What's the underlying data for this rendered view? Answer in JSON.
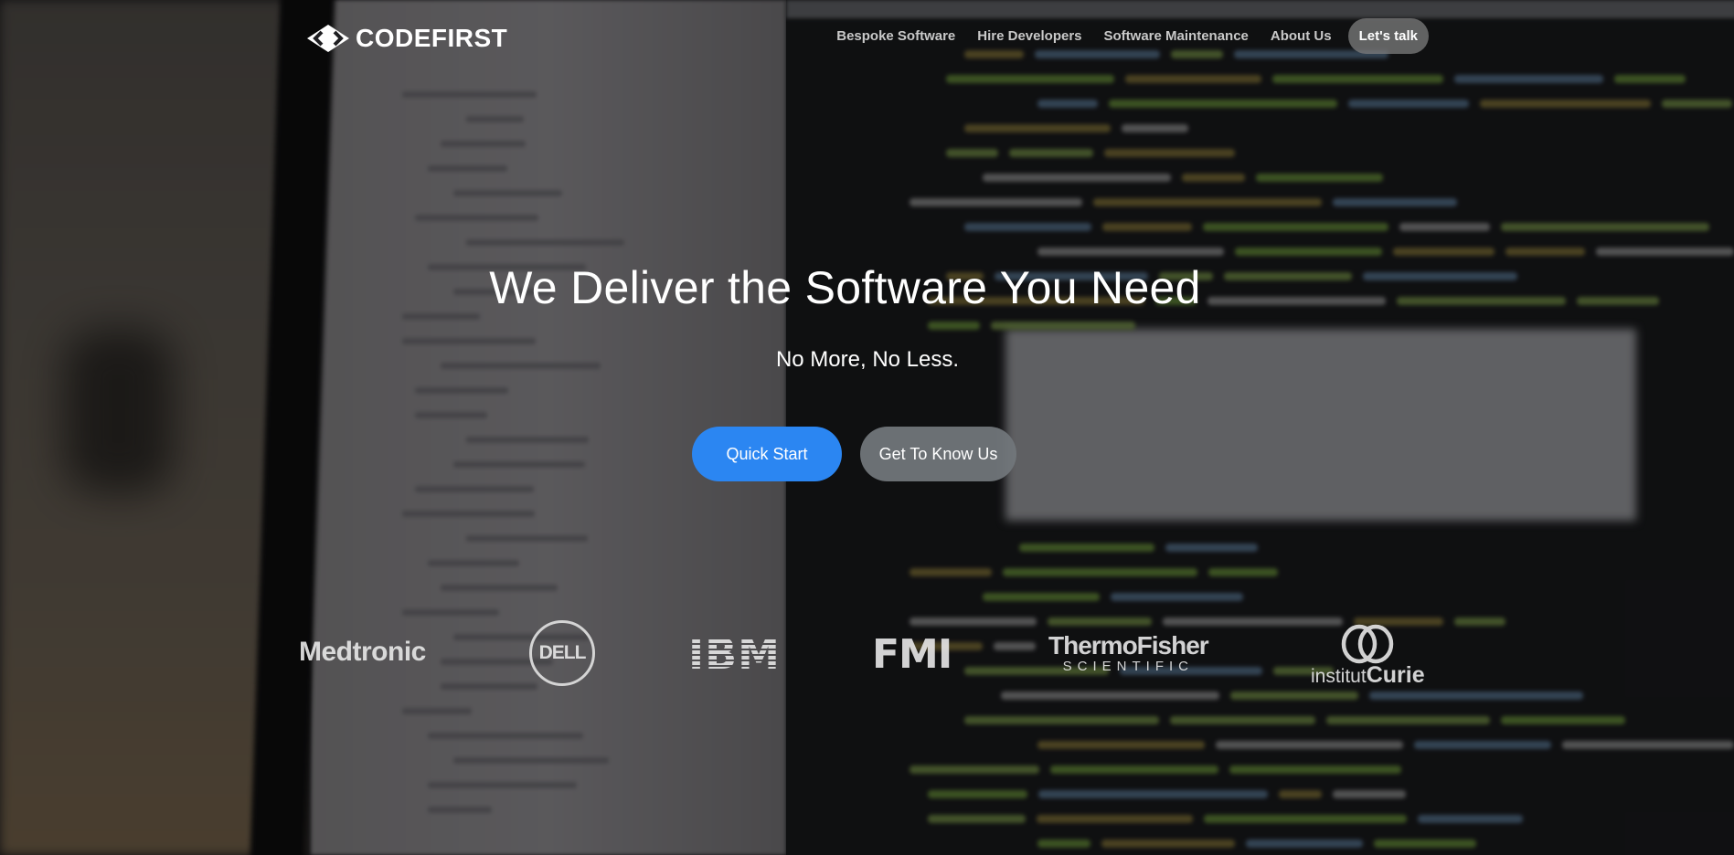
{
  "brand": {
    "logo_text": "CODEFIRST",
    "logo_icon": "diamond-chevrons-icon"
  },
  "nav": {
    "links": [
      "Bespoke Software",
      "Hire Developers",
      "Software Maintenance",
      "About Us"
    ],
    "cta": "Let's talk"
  },
  "hero": {
    "title": "We Deliver the Software You Need",
    "subtitle": "No More, No Less.",
    "primary_button": "Quick Start",
    "secondary_button": "Get To Know Us"
  },
  "clients": {
    "medtronic": "Medtronic",
    "dell": "DELL",
    "ibm": "IBM",
    "fmi": "FMI",
    "thermo_top": "ThermoFisher",
    "thermo_bottom": "SCIENTIFIC",
    "curie_prefix": "institut",
    "curie_name": "Curie"
  },
  "colors": {
    "primary_button": "#2b86f2",
    "secondary_button": "#71767a",
    "text": "#ffffff"
  }
}
